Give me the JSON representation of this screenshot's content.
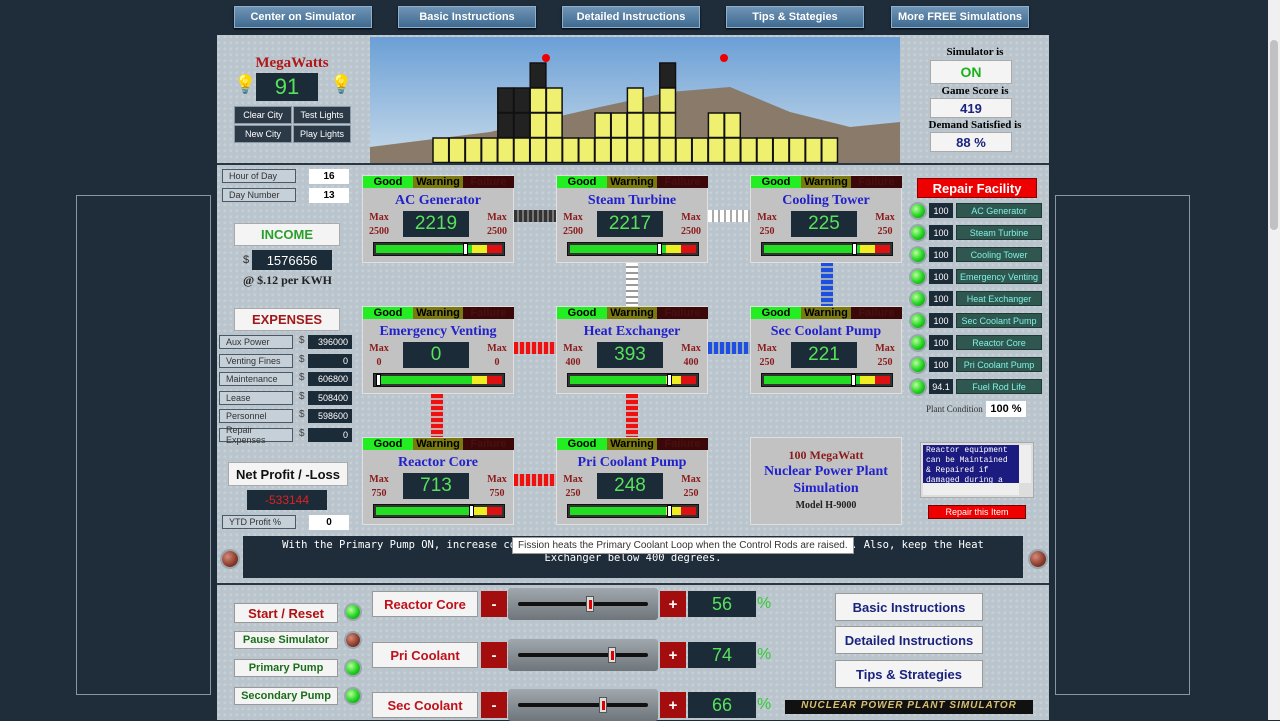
{
  "nav": [
    "Center on Simulator",
    "Basic Instructions",
    "Detailed Instructions",
    "Tips & Stategies",
    "More FREE Simulations"
  ],
  "megawatts": {
    "label": "MegaWatts",
    "value": "91",
    "buttons": [
      "Clear City",
      "Test Lights",
      "New City",
      "Play Lights"
    ]
  },
  "status": {
    "sim_label": "Simulator is",
    "sim_value": "ON",
    "score_label": "Game Score is",
    "score_value": "419",
    "demand_label": "Demand Satisfied is",
    "demand_value": "88 %"
  },
  "time": {
    "hour_label": "Hour of Day",
    "hour": "16",
    "day_label": "Day Number",
    "day": "13"
  },
  "income": {
    "label": "INCOME",
    "currency": "$",
    "value": "1576656",
    "rate": "@ $.12 per KWH"
  },
  "expenses": {
    "label": "EXPENSES",
    "items": [
      {
        "label": "Aux Power",
        "value": "396000"
      },
      {
        "label": "Venting Fines",
        "value": "0"
      },
      {
        "label": "Maintenance",
        "value": "606800"
      },
      {
        "label": "Lease",
        "value": "508400"
      },
      {
        "label": "Personnel",
        "value": "598600"
      },
      {
        "label": "Repair Expenses",
        "value": "0"
      }
    ]
  },
  "profit": {
    "label": "Net Profit / -Loss",
    "value": "-533144",
    "ytd_label": "YTD Profit %",
    "ytd": "0"
  },
  "status_labels": {
    "good": "Good",
    "warning": "Warning",
    "failure": "Failure"
  },
  "max_label": "Max",
  "components": [
    {
      "name": "AC Generator",
      "value": 2219,
      "max": 2500
    },
    {
      "name": "Steam Turbine",
      "value": 2217,
      "max": 2500
    },
    {
      "name": "Cooling Tower",
      "value": 225,
      "max": 250
    },
    {
      "name": "Emergency Venting",
      "value": 0,
      "max": 0
    },
    {
      "name": "Heat Exchanger",
      "value": 393,
      "max": 400
    },
    {
      "name": "Sec Coolant Pump",
      "value": 221,
      "max": 250
    },
    {
      "name": "Reactor Core",
      "value": 713,
      "max": 750
    },
    {
      "name": "Pri Coolant Pump",
      "value": 248,
      "max": 250
    }
  ],
  "plant_info": {
    "line1": "100 MegaWatt",
    "line2": "Nuclear Power Plant Simulation",
    "model": "Model H-9000"
  },
  "repair": {
    "title": "Repair Facility",
    "items": [
      {
        "value": "100",
        "label": "AC Generator"
      },
      {
        "value": "100",
        "label": "Steam Turbine"
      },
      {
        "value": "100",
        "label": "Cooling Tower"
      },
      {
        "value": "100",
        "label": "Emergency Venting"
      },
      {
        "value": "100",
        "label": "Heat Exchanger"
      },
      {
        "value": "100",
        "label": "Sec Coolant Pump"
      },
      {
        "value": "100",
        "label": "Reactor Core"
      },
      {
        "value": "100",
        "label": "Pri Coolant Pump"
      },
      {
        "value": "94.1",
        "label": "Fuel Rod Life"
      }
    ],
    "condition_label": "Plant Condition",
    "condition": "100 %",
    "info_text": "Reactor equipment can be Maintained & Repaired if damaged during a Warp or",
    "button": "Repair this Item"
  },
  "message": {
    "text": "With the Primary Pump ON, increase coolant flow to keep the Reactor Core below 750 degrees. Also, keep the Heat Exchanger below 400 degrees.",
    "tooltip": "Fission heats the Primary Coolant Loop when the Control Rods are raised."
  },
  "controls": {
    "buttons": [
      {
        "label": "Start / Reset",
        "on": true
      },
      {
        "label": "Pause Simulator",
        "on": false
      },
      {
        "label": "Primary Pump",
        "on": true
      },
      {
        "label": "Secondary Pump",
        "on": true
      }
    ],
    "sliders": [
      {
        "label": "Reactor Core",
        "value": "56",
        "pct": 56
      },
      {
        "label": "Pri Coolant",
        "value": "74",
        "pct": 74
      },
      {
        "label": "Sec Coolant",
        "value": "66",
        "pct": 66
      }
    ],
    "minus": "-",
    "plus": "+",
    "percent": "%"
  },
  "help_buttons": [
    "Basic Instructions",
    "Detailed Instructions",
    "Tips & Strategies"
  ],
  "logo": "NUCLEAR POWER PLANT SIMULATOR",
  "colors": {
    "good": "#22ee22",
    "warning": "#7a7a10",
    "failure": "#3a0808",
    "lcd_text": "#56e25a",
    "title_blue": "#2222cc"
  }
}
